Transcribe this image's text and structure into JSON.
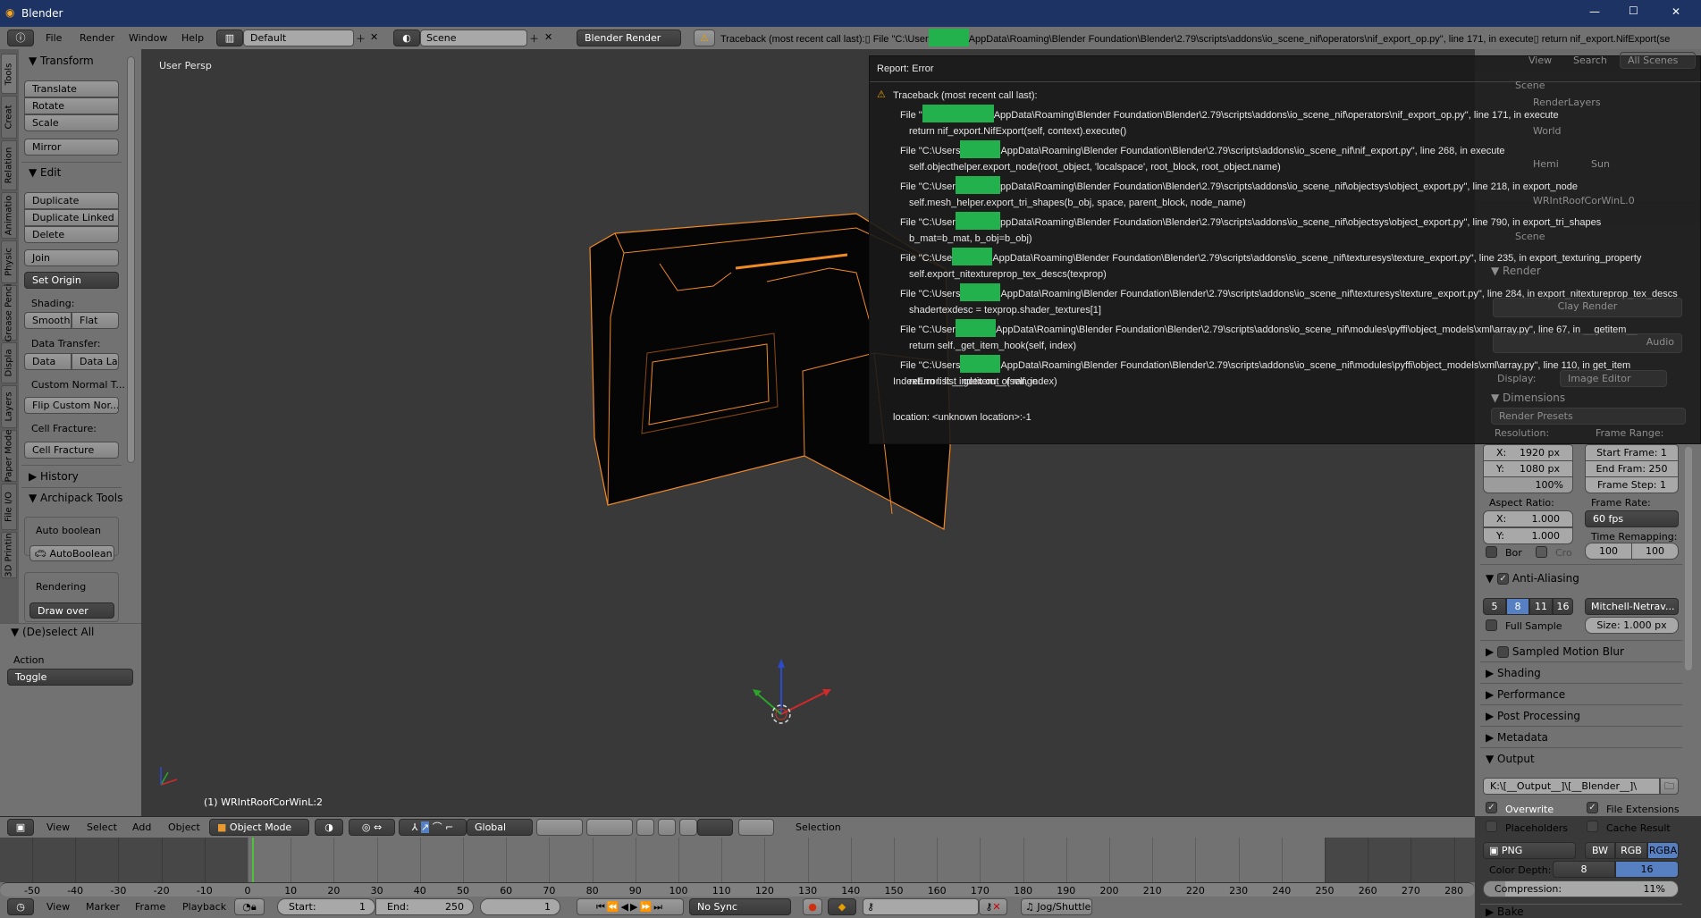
{
  "window": {
    "title": "Blender",
    "minimize": "—",
    "maximize": "☐",
    "close": "✕"
  },
  "topbar": {
    "menus": [
      "File",
      "Render",
      "Window",
      "Help"
    ],
    "screen_layout": "Default",
    "scene": "Scene",
    "render_engine": "Blender Render",
    "report_prefix": "Traceback (most recent call last):▯ File \"C:\\User",
    "report_suffix": "AppData\\Roaming\\Blender Foundation\\Blender\\2.79\\scripts\\addons\\io_scene_nif\\operators\\nif_export_op.py\", line 171, in execute▯    return nif_export.NifExport(se"
  },
  "tool_tabs": [
    "Tools",
    "Creat",
    "Relation",
    "Animatio",
    "Physic",
    "Grease Penci",
    "Displa",
    "Layers",
    "Paper Mode",
    "File I/O",
    "3D Printin"
  ],
  "tools": {
    "transform": "Transform",
    "translate": "Translate",
    "rotate": "Rotate",
    "scale": "Scale",
    "mirror": "Mirror",
    "edit": "Edit",
    "duplicate": "Duplicate",
    "duplicate_linked": "Duplicate Linked",
    "delete": "Delete",
    "join": "Join",
    "set_origin": "Set Origin",
    "shading_label": "Shading:",
    "smooth": "Smooth",
    "flat": "Flat",
    "data_transfer_label": "Data Transfer:",
    "data": "Data",
    "data_layers": "Data La",
    "custom_normal": "Custom Normal T...",
    "flip_custom": "Flip Custom Nor...",
    "cell_fracture_label": "Cell Fracture:",
    "cell_fracture": "Cell Fracture",
    "history": "History",
    "archipack": "Archipack Tools",
    "auto_boolean_label": "Auto boolean",
    "auto_boolean": "AutoBoolean",
    "rendering_label": "Rendering",
    "draw_over": "Draw over",
    "deselect_all": "(De)select All",
    "action_label": "Action",
    "action_value": "Toggle"
  },
  "viewport": {
    "view_name": "User Persp",
    "object_label": "(1) WRIntRoofCorWinL:2",
    "accent": "#f08a24"
  },
  "error_popup": {
    "title": "Report: Error",
    "header": "Traceback (most recent call last):",
    "lines": [
      {
        "pre": "File \"",
        "post": "AppData\\Roaming\\Blender Foundation\\Blender\\2.79\\scripts\\addons\\io_scene_nif\\operators\\nif_export_op.py\", line 171, in execute",
        "code": "return nif_export.NifExport(self, context).execute()"
      },
      {
        "pre": "File \"C:\\Users",
        "post": "AppData\\Roaming\\Blender Foundation\\Blender\\2.79\\scripts\\addons\\io_scene_nif\\nif_export.py\", line 268, in execute",
        "code": "self.objecthelper.export_node(root_object, 'localspace', root_block, root_object.name)"
      },
      {
        "pre": "File \"C:\\User",
        "post": "ppData\\Roaming\\Blender Foundation\\Blender\\2.79\\scripts\\addons\\io_scene_nif\\objectsys\\object_export.py\", line 218, in export_node",
        "code": "self.mesh_helper.export_tri_shapes(b_obj, space, parent_block, node_name)"
      },
      {
        "pre": "File \"C:\\User",
        "post": "ppData\\Roaming\\Blender Foundation\\Blender\\2.79\\scripts\\addons\\io_scene_nif\\objectsys\\object_export.py\", line 790, in export_tri_shapes",
        "code": "b_mat=b_mat, b_obj=b_obj)"
      },
      {
        "pre": "File \"C:\\Use",
        "post": "AppData\\Roaming\\Blender Foundation\\Blender\\2.79\\scripts\\addons\\io_scene_nif\\texturesys\\texture_export.py\", line 235, in export_texturing_property",
        "code": "self.export_nitextureprop_tex_descs(texprop)"
      },
      {
        "pre": "File \"C:\\Users",
        "post": "AppData\\Roaming\\Blender Foundation\\Blender\\2.79\\scripts\\addons\\io_scene_nif\\texturesys\\texture_export.py\", line 284, in export_nitextureprop_tex_descs",
        "code": "shadertexdesc = texprop.shader_textures[1]"
      },
      {
        "pre": "File \"C:\\User",
        "post": "AppData\\Roaming\\Blender Foundation\\Blender\\2.79\\scripts\\addons\\io_scene_nif\\modules\\pyffi\\object_models\\xml\\array.py\", line 67, in __getitem__",
        "code": "return self._get_item_hook(self, index)"
      },
      {
        "pre": "File \"C:\\Users",
        "post": "AppData\\Roaming\\Blender Foundation\\Blender\\2.79\\scripts\\addons\\io_scene_nif\\modules\\pyffi\\object_models\\xml\\array.py\", line 110, in get_item",
        "code": "return list.__getitem__(self, index)"
      }
    ],
    "error": "IndexError: list index out of range",
    "location": "location: <unknown location>:-1",
    "redaction_color": "#22b14c"
  },
  "outliner": {
    "view": "View",
    "search": "Search",
    "filter": "All Scenes",
    "items": [
      "Scene",
      "RenderLayers",
      "World",
      "Hemi",
      "Sun",
      "WRIntRoofCorWinL.0"
    ]
  },
  "properties": {
    "context": "Scene",
    "render_panel": "Render",
    "clay_render": "Clay Render",
    "audio": "Audio",
    "display_label": "Display:",
    "display_value": "Image Editor",
    "dimensions": "Dimensions",
    "render_presets": "Render Presets",
    "resolution_label": "Resolution:",
    "frame_range_label": "Frame Range:",
    "res_x": "X:",
    "res_x_value": "1920 px",
    "res_y": "Y:",
    "res_y_value": "1080 px",
    "res_pct": "100%",
    "start_frame": "Start Frame: 1",
    "end_frame": "End Fram: 250",
    "frame_step": "Frame Step: 1",
    "aspect_label": "Aspect Ratio:",
    "aspect_x": "X:",
    "aspect_x_value": "1.000",
    "aspect_y": "Y:",
    "aspect_y_value": "1.000",
    "frame_rate_label": "Frame Rate:",
    "frame_rate": "60 fps",
    "time_remap_label": "Time Remapping:",
    "remap_old": "100",
    "remap_new": "100",
    "border": "Bor",
    "crop": "Cro",
    "anti_aliasing": "Anti-Aliasing",
    "aa_samples": [
      "5",
      "8",
      "11",
      "16"
    ],
    "aa_selected": "8",
    "aa_filter": "Mitchell-Netrav...",
    "full_sample": "Full Sample",
    "filter_size": "Size: 1.000 px",
    "motion_blur": "Sampled Motion Blur",
    "shading": "Shading",
    "performance": "Performance",
    "post_processing": "Post Processing",
    "metadata": "Metadata",
    "output": "Output",
    "output_path": "K:\\[__Output__]\\[__Blender__]\\",
    "overwrite": "Overwrite",
    "file_extensions": "File Extensions",
    "placeholders": "Placeholders",
    "cache_result": "Cache Result",
    "format": "PNG",
    "color_modes": [
      "BW",
      "RGB",
      "RGBA"
    ],
    "color_mode_selected": "RGBA",
    "color_depth_label": "Color Depth:",
    "depths": [
      "8",
      "16"
    ],
    "depth_selected": "16",
    "compression_label": "Compression:",
    "compression": "11%",
    "compression_value": 11,
    "bake": "Bake",
    "selected_color": "#5680c2"
  },
  "view3d_header": {
    "menus": [
      "View",
      "Select",
      "Add",
      "Object"
    ],
    "mode": "Object Mode",
    "orientation": "Global",
    "selection": "Selection"
  },
  "timeline": {
    "ticks": [
      -50,
      -40,
      -30,
      -20,
      -10,
      0,
      10,
      20,
      30,
      40,
      50,
      60,
      70,
      80,
      90,
      100,
      110,
      120,
      130,
      140,
      150,
      160,
      170,
      180,
      190,
      200,
      210,
      220,
      230,
      240,
      250,
      260,
      270,
      280
    ],
    "current_frame": 1,
    "start": 1,
    "end": 250,
    "cursor_color": "#4fc13a"
  },
  "timeline_header": {
    "menus": [
      "View",
      "Marker",
      "Frame",
      "Playback"
    ],
    "start_label": "Start:",
    "start": "1",
    "end_label": "End:",
    "end": "250",
    "current": "1",
    "sync": "No Sync",
    "keying_set": "",
    "jog": "Jog/Shuttle"
  }
}
